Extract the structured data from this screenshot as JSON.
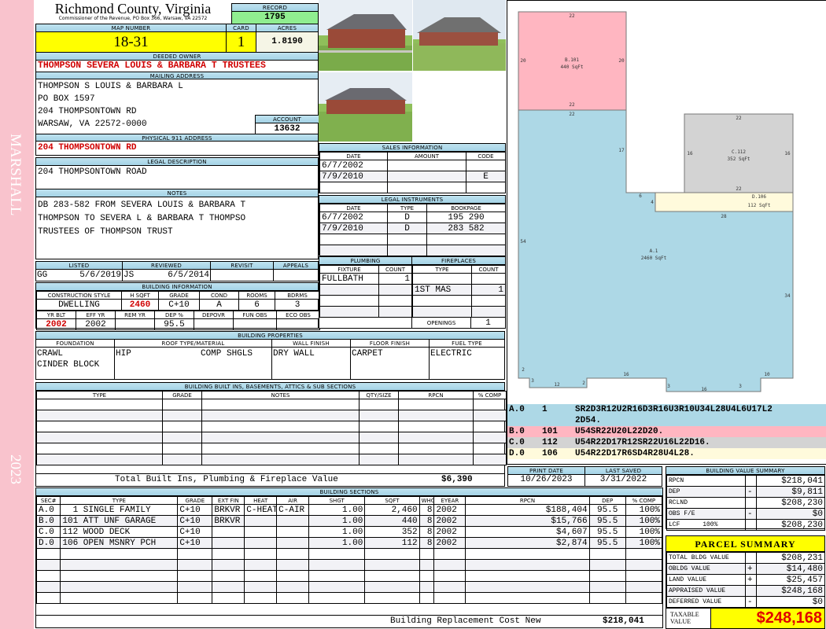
{
  "side": {
    "district": "MARSHALL",
    "year": "2023"
  },
  "header": {
    "county": "Richmond County, Virginia",
    "office": "Commissioner of the Revenue, PO Box 366, Warsaw, VA 22572",
    "record_label": "RECORD",
    "record": "1795"
  },
  "map": {
    "map_label": "MAP NUMBER",
    "map": "18-31",
    "card_label": "CARD",
    "card": "1",
    "acres_label": "ACRES",
    "acres": "1.8190"
  },
  "owner": {
    "label": "DEEDED OWNER",
    "value": "THOMPSON SEVERA LOUIS & BARBARA T TRUSTEES"
  },
  "mailing": {
    "label": "MAILING ADDRESS",
    "lines": [
      "THOMPSON S LOUIS & BARBARA L",
      "PO BOX 1597",
      "204 THOMPSONTOWN RD",
      "WARSAW, VA 22572-0000"
    ],
    "account_label": "ACCOUNT",
    "account": "13632"
  },
  "physical": {
    "label": "PHYSICAL 911 ADDRESS",
    "value": "204 THOMPSONTOWN RD"
  },
  "legal": {
    "label": "LEGAL DESCRIPTION",
    "value": "204 THOMPSONTOWN ROAD"
  },
  "notes": {
    "label": "NOTES",
    "lines": [
      "DB 283-582 FROM SEVERA LOUIS & BARBARA T",
      "THOMPSON TO SEVERA L & BARBARA T THOMPSO",
      "TRUSTEES OF THOMPSON TRUST"
    ]
  },
  "review": {
    "headers": [
      "LISTED",
      "REVIEWED",
      "REVISIT",
      "APPEALS"
    ],
    "rows": [
      [
        "GG",
        "5/6/2019",
        "JS",
        "6/5/2014",
        "",
        ""
      ]
    ]
  },
  "building_info": {
    "label": "BUILDING INFORMATION",
    "headers1": [
      "CONSTRUCTION STYLE",
      "H SQFT",
      "GRADE",
      "COND",
      "ROOMS",
      "BDRMS"
    ],
    "row1": [
      [
        "DWELLING",
        "2460",
        "C+10",
        "A",
        "6",
        "3"
      ]
    ],
    "headers2": [
      "YR BLT",
      "EFF YR",
      "REM YR",
      "DEP %",
      "DEPOVR",
      "FUN OBS",
      "ECO OBS"
    ],
    "row2": [
      [
        "2002",
        "2002",
        "",
        "95.5",
        "",
        "",
        ""
      ]
    ]
  },
  "building_props": {
    "label": "BUILDING PROPERTIES",
    "headers": [
      "FOUNDATION",
      "ROOF TYPE/MATERIAL",
      "WALL FINISH",
      "FLOOR FINISH",
      "FUEL TYPE"
    ],
    "foundation": [
      "CRAWL",
      "CINDER BLOCK"
    ],
    "roof": "HIP",
    "roof_material": "COMP SHGLS",
    "wall": "DRY WALL",
    "floor": "CARPET",
    "fuel": "ELECTRIC"
  },
  "built_ins": {
    "label": "BUILDING BUILT INS, BASEMENTS, ATTICS & SUB SECTIONS",
    "headers": [
      "TYPE",
      "GRADE",
      "NOTES",
      "QTY/SIZE",
      "RPCN",
      "% COMP"
    ],
    "total_label": "Total Built Ins, Plumbing & Fireplace Value",
    "total": "$6,390"
  },
  "sales": {
    "label": "SALES INFORMATION",
    "headers": [
      "DATE",
      "AMOUNT",
      "CODE"
    ],
    "rows": [
      [
        "6/7/2002",
        "",
        ""
      ],
      [
        "7/9/2010",
        "",
        "E"
      ]
    ]
  },
  "instruments": {
    "label": "LEGAL INSTRUMENTS",
    "headers": [
      "DATE",
      "TYPE",
      "BOOKPAGE"
    ],
    "rows": [
      [
        "6/7/2002",
        "D",
        "195 290"
      ],
      [
        "7/9/2010",
        "D",
        "283 582"
      ]
    ]
  },
  "plumbing": {
    "label": "PLUMBING",
    "headers": [
      "FIXTURE",
      "COUNT"
    ],
    "rows": [
      [
        "FULLBATH",
        "1"
      ]
    ]
  },
  "fireplaces": {
    "label": "FIREPLACES",
    "headers": [
      "TYPE",
      "COUNT"
    ],
    "rows": [
      [
        "",
        ""
      ],
      [
        "1ST MAS",
        "1"
      ]
    ],
    "openings_label": "OPENINGS",
    "openings": "1"
  },
  "sketch": {
    "areas": [
      {
        "id": "B.101",
        "sqft": "440 SqFt"
      },
      {
        "id": "C.112",
        "sqft": "352 SqFt"
      },
      {
        "id": "D.106",
        "sqft": "112 SqFt"
      },
      {
        "id": "A.1",
        "sqft": "2460 SqFt"
      }
    ],
    "dims": [
      "22",
      "20",
      "20",
      "22",
      "22",
      "17",
      "22",
      "16",
      "16",
      "22",
      "6",
      "4",
      "28",
      "54",
      "34",
      "2",
      "3",
      "12",
      "2",
      "16",
      "3",
      "16",
      "3",
      "10"
    ],
    "codes": [
      [
        "A.0",
        "1",
        "SR2D3R12U2R16D3R16U3R10U34L28U4L6U17L2"
      ],
      [
        "",
        "",
        "2D54."
      ],
      [
        "B.0",
        "101",
        "U54SR22U20L22D20."
      ],
      [
        "C.0",
        "112",
        "U54R22D17R12SR22U16L22D16."
      ],
      [
        "D.0",
        "106",
        "U54R22D17R6SD4R28U4L28."
      ]
    ],
    "colors": {
      "A": "#add8e6",
      "B": "#ffb6c1",
      "C": "#d3d3d3",
      "D": "#fffadc"
    }
  },
  "dates": {
    "print_label": "PRINT DATE",
    "print": "10/26/2023",
    "saved_label": "LAST SAVED",
    "saved": "3/31/2022"
  },
  "sections": {
    "label": "BUILDING SECTIONS",
    "headers": [
      "SEC#",
      "TYPE",
      "GRADE",
      "EXT FIN",
      "HEAT",
      "AIR",
      "SHGT",
      "SQFT",
      "WHGT",
      "EYEAR",
      "RPCN",
      "DEP",
      "% COMP"
    ],
    "rows": [
      [
        "A.0",
        "  1 SINGLE FAMILY",
        "C+10",
        "BRKVR",
        "C-HEAT",
        "C-AIR",
        "1.00",
        "2,460",
        "8",
        "2002",
        "$188,404",
        "95.5",
        "100%"
      ],
      [
        "B.0",
        "101 ATT UNF GARAGE",
        "C+10",
        "BRKVR",
        "",
        "",
        "1.00",
        "440",
        "8",
        "2002",
        "$15,766",
        "95.5",
        "100%"
      ],
      [
        "C.0",
        "112 WOOD DECK",
        "C+10",
        "",
        "",
        "",
        "1.00",
        "352",
        "8",
        "2002",
        "$4,607",
        "95.5",
        "100%"
      ],
      [
        "D.0",
        "106 OPEN MSNRY PCH",
        "C+10",
        "",
        "",
        "",
        "1.00",
        "112",
        "8",
        "2002",
        "$2,874",
        "95.5",
        "100%"
      ]
    ],
    "total_label": "Building Replacement Cost New",
    "total": "$218,041"
  },
  "value_summary": {
    "label": "BUILDING VALUE SUMMARY",
    "rows": [
      [
        "RPCN",
        "",
        "$218,041"
      ],
      [
        "DEP",
        "-",
        "$9,811"
      ],
      [
        "RCLND",
        "",
        "$208,230"
      ],
      [
        "OBS F/E",
        "-",
        "$0"
      ],
      [
        "LCF      100%",
        "",
        "$208,230"
      ]
    ]
  },
  "parcel": {
    "label": "PARCEL SUMMARY",
    "rows": [
      [
        "TOTAL BLDG VALUE",
        "",
        "$208,231"
      ],
      [
        "OBLDG VALUE",
        "+",
        "$14,480"
      ],
      [
        "LAND VALUE",
        "+",
        "$25,457"
      ],
      [
        "APPRAISED VALUE",
        "",
        "$248,168"
      ],
      [
        "DEFERRED VALUE",
        "-",
        "$0"
      ]
    ],
    "taxable_label": "TAXABLE VALUE",
    "taxable": "$248,168"
  }
}
